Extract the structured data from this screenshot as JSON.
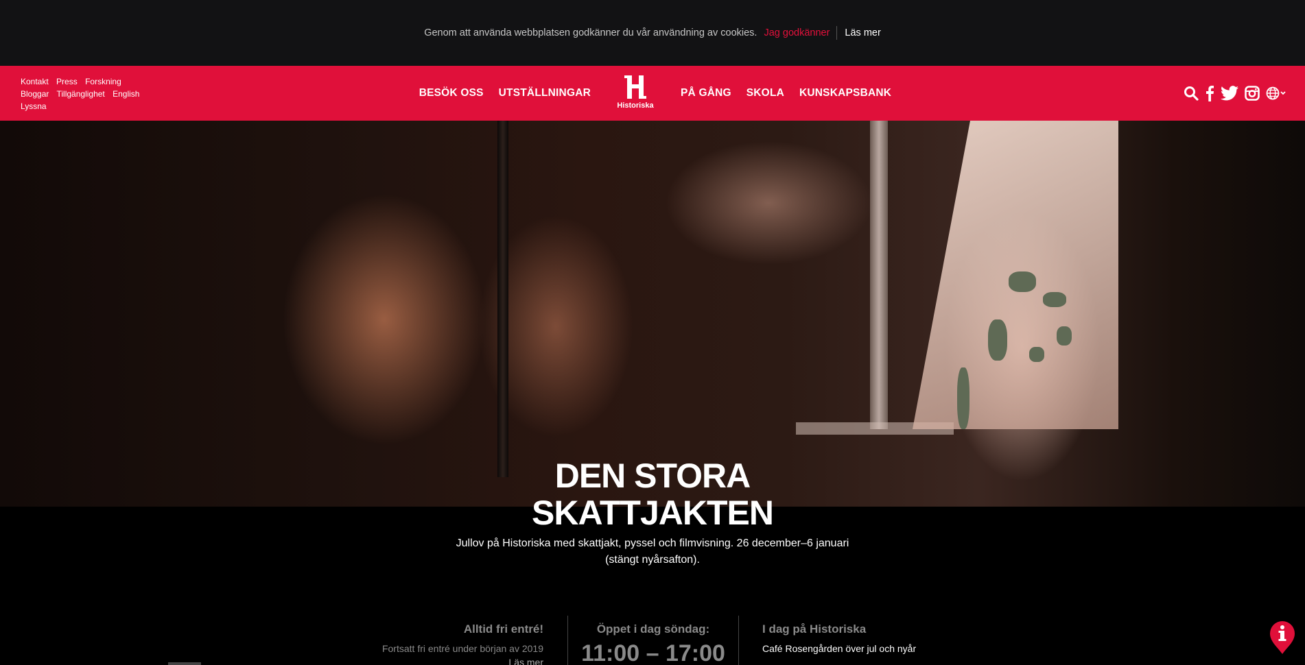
{
  "cookie": {
    "message": "Genom att använda webbplatsen godkänner du vår användning av cookies.",
    "accept_label": "Jag godkänner",
    "more_label": "Läs mer"
  },
  "header": {
    "utility_links": [
      [
        "Kontakt",
        "Press",
        "Forskning"
      ],
      [
        "Bloggar",
        "Tillgänglighet",
        "English"
      ],
      [
        "Lyssna"
      ]
    ],
    "nav_left": [
      "BESÖK OSS",
      "UTSTÄLLNINGAR"
    ],
    "nav_right": [
      "PÅ GÅNG",
      "SKOLA",
      "KUNSKAPSBANK"
    ],
    "logo_text": "Historiska",
    "icons": [
      "search-icon",
      "facebook-icon",
      "twitter-icon",
      "instagram-icon",
      "language-globe-icon"
    ]
  },
  "hero": {
    "title_line1": "DEN STORA",
    "title_line2": "SKATTJAKTEN",
    "subtitle_line1": "Jullov på Historiska med skattjakt, pyssel och filmvisning. 26 december–6 januari",
    "subtitle_line2": "(stängt nyårsafton)."
  },
  "info": {
    "free_entry_heading": "Alltid fri entré!",
    "free_entry_text": "Fortsatt fri entré under början av 2019",
    "free_entry_link": "Läs mer",
    "open_heading": "Öppet i dag söndag:",
    "open_hours": "11:00 – 17:00",
    "today_heading": "I dag på Historiska",
    "today_item": "Café Rosengården över jul och nyår"
  },
  "colors": {
    "brand_red": "#e0103a",
    "cookie_bg": "#121214",
    "accept_red": "#e4103b"
  }
}
